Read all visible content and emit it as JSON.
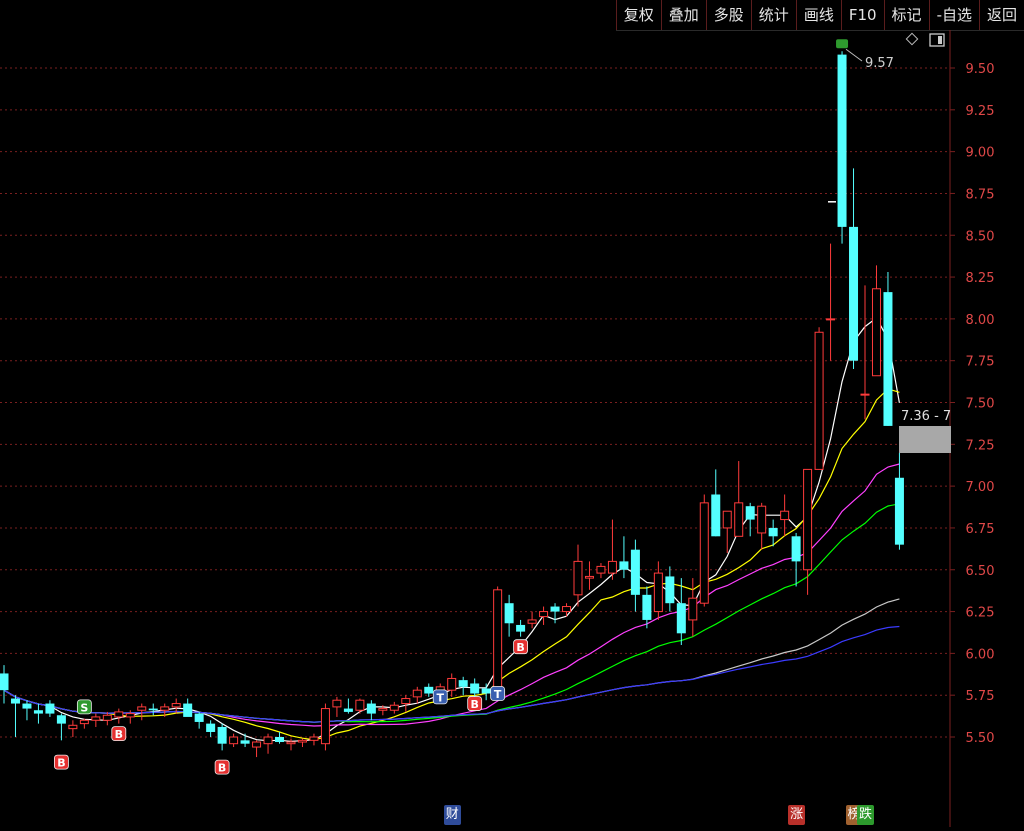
{
  "toolbar": {
    "buttons": [
      "复权",
      "叠加",
      "多股",
      "统计",
      "画线",
      "F10",
      "标记",
      "-自选",
      "返回"
    ]
  },
  "chart_data": {
    "type": "candlestick",
    "y_ticks": [
      "9.50",
      "9.25",
      "9.00",
      "8.75",
      "8.50",
      "8.25",
      "8.00",
      "7.75",
      "7.50",
      "7.25",
      "7.00",
      "6.75",
      "6.50",
      "6.25",
      "6.00",
      "5.75",
      "5.50"
    ],
    "ylim": [
      5.35,
      9.67
    ],
    "high_label": "9.57",
    "price_tag": "7.36 - 7",
    "colors": {
      "up": "#ff3b3b",
      "down": "#54ffff",
      "ma5": "#ffffff",
      "ma10": "#ffff00",
      "ma20": "#ff40ff",
      "ma30": "#00ff00",
      "ma60": "#c8c8c8",
      "ma120": "#3b3bff",
      "grid": "#7a1f1f"
    },
    "candles": [
      [
        5.88,
        5.93,
        5.7,
        5.78
      ],
      [
        5.73,
        5.75,
        5.5,
        5.7
      ],
      [
        5.7,
        5.72,
        5.6,
        5.67
      ],
      [
        5.66,
        5.7,
        5.58,
        5.64
      ],
      [
        5.7,
        5.72,
        5.62,
        5.64
      ],
      [
        5.63,
        5.64,
        5.48,
        5.58
      ],
      [
        5.55,
        5.6,
        5.5,
        5.57
      ],
      [
        5.58,
        5.61,
        5.55,
        5.6
      ],
      [
        5.6,
        5.64,
        5.56,
        5.62
      ],
      [
        5.6,
        5.65,
        5.57,
        5.63
      ],
      [
        5.62,
        5.67,
        5.58,
        5.65
      ],
      [
        5.62,
        5.66,
        5.58,
        5.64
      ],
      [
        5.66,
        5.7,
        5.6,
        5.68
      ],
      [
        5.67,
        5.7,
        5.63,
        5.66
      ],
      [
        5.66,
        5.7,
        5.62,
        5.68
      ],
      [
        5.68,
        5.73,
        5.64,
        5.7
      ],
      [
        5.7,
        5.73,
        5.63,
        5.62
      ],
      [
        5.64,
        5.65,
        5.55,
        5.59
      ],
      [
        5.58,
        5.6,
        5.5,
        5.53
      ],
      [
        5.56,
        5.58,
        5.42,
        5.46
      ],
      [
        5.46,
        5.52,
        5.44,
        5.5
      ],
      [
        5.48,
        5.52,
        5.44,
        5.46
      ],
      [
        5.44,
        5.48,
        5.38,
        5.47
      ],
      [
        5.46,
        5.52,
        5.4,
        5.5
      ],
      [
        5.5,
        5.53,
        5.46,
        5.47
      ],
      [
        5.46,
        5.49,
        5.42,
        5.47
      ],
      [
        5.47,
        5.49,
        5.44,
        5.48
      ],
      [
        5.48,
        5.52,
        5.45,
        5.5
      ],
      [
        5.46,
        5.7,
        5.42,
        5.67
      ],
      [
        5.68,
        5.74,
        5.62,
        5.72
      ],
      [
        5.67,
        5.73,
        5.64,
        5.65
      ],
      [
        5.66,
        5.73,
        5.64,
        5.72
      ],
      [
        5.7,
        5.72,
        5.6,
        5.64
      ],
      [
        5.66,
        5.69,
        5.63,
        5.67
      ],
      [
        5.66,
        5.71,
        5.64,
        5.69
      ],
      [
        5.7,
        5.75,
        5.65,
        5.73
      ],
      [
        5.74,
        5.8,
        5.7,
        5.78
      ],
      [
        5.8,
        5.82,
        5.74,
        5.76
      ],
      [
        5.76,
        5.82,
        5.7,
        5.8
      ],
      [
        5.78,
        5.88,
        5.74,
        5.85
      ],
      [
        5.84,
        5.86,
        5.75,
        5.8
      ],
      [
        5.82,
        5.85,
        5.73,
        5.76
      ],
      [
        5.79,
        5.82,
        5.72,
        5.76
      ],
      [
        5.8,
        6.4,
        5.8,
        6.38
      ],
      [
        6.3,
        6.35,
        6.1,
        6.18
      ],
      [
        6.17,
        6.2,
        6.1,
        6.13
      ],
      [
        6.18,
        6.25,
        6.15,
        6.2
      ],
      [
        6.22,
        6.28,
        6.17,
        6.25
      ],
      [
        6.28,
        6.3,
        6.18,
        6.25
      ],
      [
        6.25,
        6.3,
        6.22,
        6.28
      ],
      [
        6.35,
        6.65,
        6.28,
        6.55
      ],
      [
        6.45,
        6.55,
        6.38,
        6.46
      ],
      [
        6.48,
        6.54,
        6.45,
        6.52
      ],
      [
        6.48,
        6.8,
        6.44,
        6.55
      ],
      [
        6.55,
        6.7,
        6.45,
        6.5
      ],
      [
        6.62,
        6.68,
        6.25,
        6.35
      ],
      [
        6.35,
        6.4,
        6.15,
        6.2
      ],
      [
        6.25,
        6.55,
        6.2,
        6.48
      ],
      [
        6.46,
        6.52,
        6.25,
        6.3
      ],
      [
        6.3,
        6.45,
        6.05,
        6.12
      ],
      [
        6.2,
        6.45,
        6.1,
        6.33
      ],
      [
        6.3,
        6.95,
        6.28,
        6.9
      ],
      [
        6.95,
        7.1,
        6.7,
        6.7
      ],
      [
        6.75,
        6.85,
        6.6,
        6.85
      ],
      [
        6.7,
        7.15,
        6.7,
        6.9
      ],
      [
        6.88,
        6.9,
        6.7,
        6.8
      ],
      [
        6.72,
        6.9,
        6.62,
        6.88
      ],
      [
        6.75,
        6.8,
        6.64,
        6.7
      ],
      [
        6.8,
        6.95,
        6.7,
        6.85
      ],
      [
        6.7,
        6.72,
        6.4,
        6.55
      ],
      [
        6.5,
        7.1,
        6.35,
        7.1
      ],
      [
        7.1,
        7.95,
        7.1,
        7.92
      ],
      [
        8.0,
        8.45,
        7.75,
        8.0
      ],
      [
        9.58,
        9.6,
        8.45,
        8.55
      ],
      [
        8.55,
        8.9,
        7.7,
        7.75
      ],
      [
        7.55,
        8.2,
        7.4,
        7.55
      ],
      [
        7.66,
        8.32,
        7.66,
        8.18
      ],
      [
        8.16,
        8.28,
        7.36,
        7.36
      ],
      [
        7.05,
        7.2,
        6.62,
        6.65
      ]
    ]
  },
  "markers": [
    {
      "label": "B",
      "kind": "buy",
      "index": 5,
      "value": 5.35
    },
    {
      "label": "S",
      "kind": "sell",
      "index": 7,
      "value": 5.68
    },
    {
      "label": "B",
      "kind": "buy",
      "index": 10,
      "value": 5.52
    },
    {
      "label": "B",
      "kind": "buy",
      "index": 19,
      "value": 5.32
    },
    {
      "label": "T",
      "kind": "event",
      "index": 38,
      "value": 5.74
    },
    {
      "label": "B",
      "kind": "buy",
      "index": 41,
      "value": 5.7
    },
    {
      "label": "T",
      "kind": "event",
      "index": 43,
      "value": 5.76
    },
    {
      "label": "B",
      "kind": "buy",
      "index": 45,
      "value": 6.04
    }
  ],
  "bottom_markers": [
    {
      "label": "财",
      "bg": "#2f4c9a",
      "index": 39
    },
    {
      "label": "涨",
      "bg": "#b8302a",
      "index": 69
    },
    {
      "label": "榜",
      "bg": "#a0612f",
      "index": 74
    },
    {
      "label": "跌",
      "bg": "#2d9a2d",
      "index": 75
    }
  ]
}
